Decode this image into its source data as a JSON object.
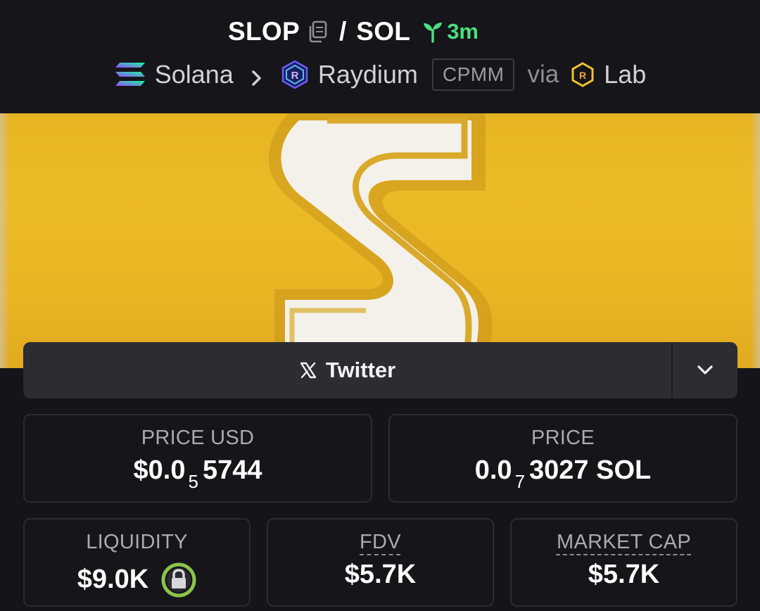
{
  "header": {
    "base_symbol": "SLOP",
    "separator": "/",
    "quote_symbol": "SOL",
    "age": "3m",
    "chain": "Solana",
    "dex": "Raydium",
    "pool_type": "CPMM",
    "via_label": "via",
    "launchpad": "Lab"
  },
  "social": {
    "twitter_label": "Twitter"
  },
  "stats": {
    "price_usd": {
      "label": "PRICE USD",
      "prefix": "$0.0",
      "zeros": "5",
      "digits": "5744"
    },
    "price": {
      "label": "PRICE",
      "prefix": "0.0",
      "zeros": "7",
      "digits": "3027 SOL"
    },
    "liquidity": {
      "label": "LIQUIDITY",
      "value": "$9.0K"
    },
    "fdv": {
      "label": "FDV",
      "value": "$5.7K"
    },
    "market_cap": {
      "label": "MARKET CAP",
      "value": "$5.7K"
    }
  },
  "icons": {
    "copy": "copy-icon",
    "age": "sprout-icon",
    "chain": "solana-logo-icon",
    "dex": "raydium-logo-icon",
    "launchpad": "lab-logo-icon",
    "twitter": "x-icon",
    "expand": "chevron-down-icon",
    "liquidity_lock": "lock-icon"
  },
  "colors": {
    "background": "#141419",
    "age_green": "#4ade80",
    "banner_yellow": "#edbb27",
    "lock_green": "#8bc34a"
  }
}
